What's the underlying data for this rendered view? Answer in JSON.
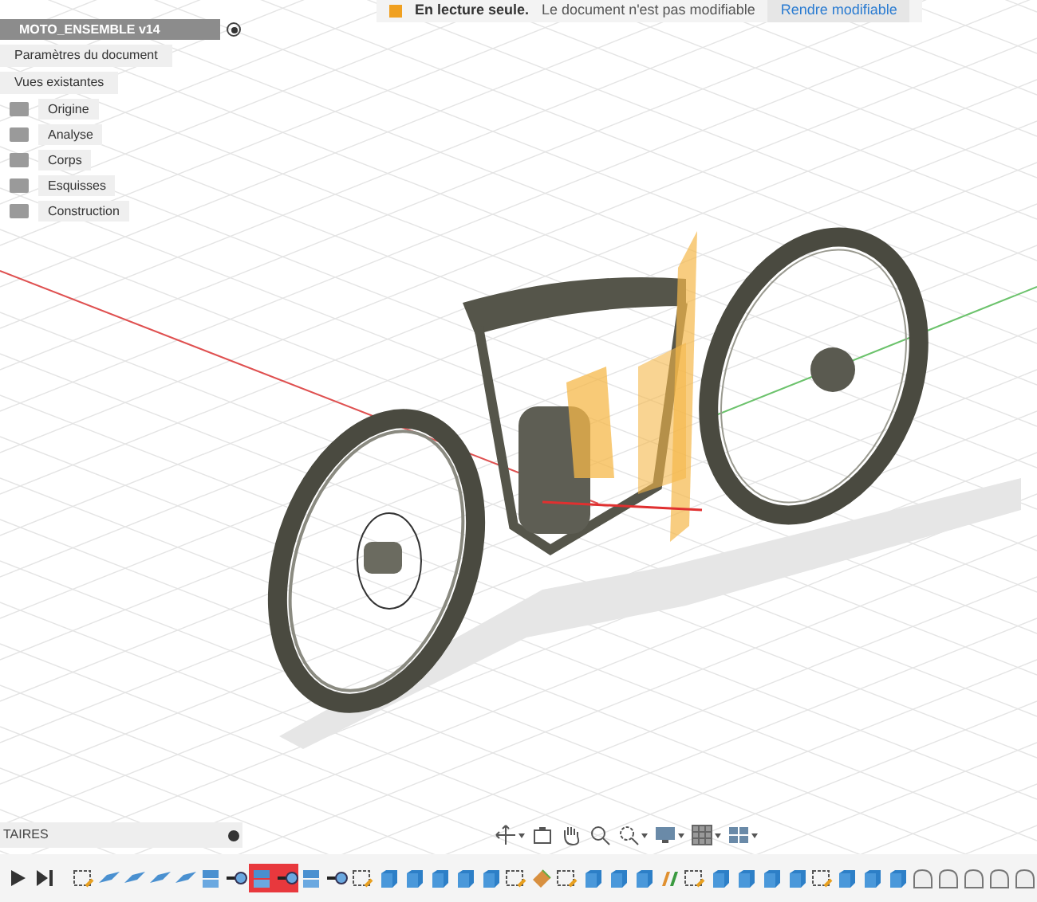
{
  "banner": {
    "title": "En lecture seule.",
    "message": "Le document n'est pas modifiable",
    "action": "Rendre modifiable"
  },
  "browser": {
    "root": {
      "label": "MOTO_ENSEMBLE v14"
    },
    "items": [
      {
        "label": "Paramètres du document",
        "kind": "node"
      },
      {
        "label": "Vues existantes",
        "kind": "node"
      },
      {
        "label": "Origine",
        "kind": "folder"
      },
      {
        "label": "Analyse",
        "kind": "folder"
      },
      {
        "label": "Corps",
        "kind": "folder"
      },
      {
        "label": "Esquisses",
        "kind": "folder"
      },
      {
        "label": "Construction",
        "kind": "folder"
      }
    ]
  },
  "comments_panel": {
    "title": "TAIRES"
  },
  "timeline": {
    "items": [
      {
        "kind": "sketch",
        "selected": false
      },
      {
        "kind": "plane",
        "selected": false
      },
      {
        "kind": "plane",
        "selected": false
      },
      {
        "kind": "plane",
        "selected": false
      },
      {
        "kind": "plane",
        "selected": false
      },
      {
        "kind": "body",
        "selected": false
      },
      {
        "kind": "joint",
        "selected": false
      },
      {
        "kind": "body",
        "selected": true
      },
      {
        "kind": "joint",
        "selected": true
      },
      {
        "kind": "body",
        "selected": false
      },
      {
        "kind": "joint",
        "selected": false
      },
      {
        "kind": "sketch",
        "selected": false
      },
      {
        "kind": "extrude",
        "selected": false
      },
      {
        "kind": "extrude",
        "selected": false
      },
      {
        "kind": "extrude",
        "selected": false
      },
      {
        "kind": "extrude",
        "selected": false
      },
      {
        "kind": "extrude",
        "selected": false
      },
      {
        "kind": "sketch",
        "selected": false
      },
      {
        "kind": "paint",
        "selected": false
      },
      {
        "kind": "sketch",
        "selected": false
      },
      {
        "kind": "extrude",
        "selected": false
      },
      {
        "kind": "extrude",
        "selected": false
      },
      {
        "kind": "extrude",
        "selected": false
      },
      {
        "kind": "split",
        "selected": false
      },
      {
        "kind": "sketch",
        "selected": false
      },
      {
        "kind": "extrude",
        "selected": false
      },
      {
        "kind": "extrude",
        "selected": false
      },
      {
        "kind": "extrude",
        "selected": false
      },
      {
        "kind": "extrude",
        "selected": false
      },
      {
        "kind": "sketch",
        "selected": false
      },
      {
        "kind": "extrude",
        "selected": false
      },
      {
        "kind": "extrude",
        "selected": false
      },
      {
        "kind": "extrude",
        "selected": false
      },
      {
        "kind": "fillet",
        "selected": false
      },
      {
        "kind": "fillet",
        "selected": false
      },
      {
        "kind": "fillet",
        "selected": false
      },
      {
        "kind": "fillet",
        "selected": false
      },
      {
        "kind": "fillet",
        "selected": false
      }
    ]
  }
}
